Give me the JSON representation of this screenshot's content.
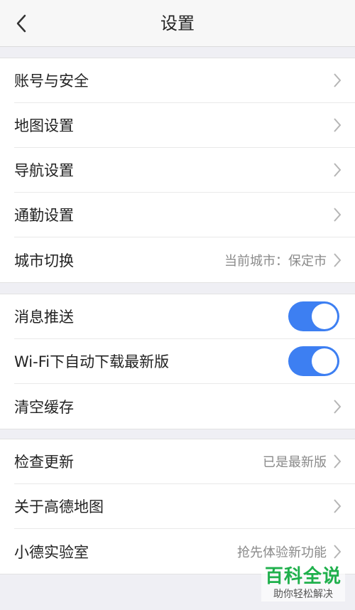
{
  "header": {
    "title": "设置"
  },
  "groups": {
    "account": [
      {
        "label": "账号与安全"
      },
      {
        "label": "地图设置"
      },
      {
        "label": "导航设置"
      },
      {
        "label": "通勤设置"
      },
      {
        "label": "城市切换",
        "value": "当前城市：保定市"
      }
    ],
    "prefs": [
      {
        "label": "消息推送",
        "toggle": "on"
      },
      {
        "label": "Wi-Fi下自动下载最新版",
        "toggle": "on"
      },
      {
        "label": "清空缓存"
      }
    ],
    "about": [
      {
        "label": "检查更新",
        "value": "已是最新版"
      },
      {
        "label": "关于高德地图"
      },
      {
        "label": "小德实验室",
        "value": "抢先体验新功能"
      }
    ]
  },
  "watermark": {
    "main": "百科全说",
    "sub": "助你轻松解决"
  },
  "colors": {
    "toggle_on": "#3d7ff2",
    "watermark": "#1fb04c"
  }
}
